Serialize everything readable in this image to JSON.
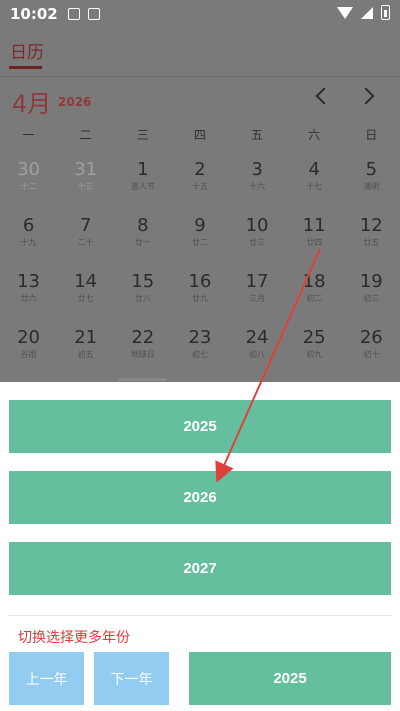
{
  "status": {
    "time": "10:02"
  },
  "calendar": {
    "tab": "日历",
    "month": "4月",
    "year": "2026",
    "weekdays": [
      "一",
      "二",
      "三",
      "四",
      "五",
      "六",
      "日"
    ],
    "weeks": [
      [
        {
          "d": "30",
          "l": "十二",
          "dim": true
        },
        {
          "d": "31",
          "l": "十三",
          "dim": true
        },
        {
          "d": "1",
          "l": "愚人节"
        },
        {
          "d": "2",
          "l": "十五"
        },
        {
          "d": "3",
          "l": "十六"
        },
        {
          "d": "4",
          "l": "十七"
        },
        {
          "d": "5",
          "l": "清明"
        }
      ],
      [
        {
          "d": "6",
          "l": "十九"
        },
        {
          "d": "7",
          "l": "二十"
        },
        {
          "d": "8",
          "l": "廿一"
        },
        {
          "d": "9",
          "l": "廿二"
        },
        {
          "d": "10",
          "l": "廿三"
        },
        {
          "d": "11",
          "l": "廿四"
        },
        {
          "d": "12",
          "l": "廿五"
        }
      ],
      [
        {
          "d": "13",
          "l": "廿六"
        },
        {
          "d": "14",
          "l": "廿七"
        },
        {
          "d": "15",
          "l": "廿八"
        },
        {
          "d": "16",
          "l": "廿九"
        },
        {
          "d": "17",
          "l": "三月"
        },
        {
          "d": "18",
          "l": "初二"
        },
        {
          "d": "19",
          "l": "初三"
        }
      ],
      [
        {
          "d": "20",
          "l": "谷雨"
        },
        {
          "d": "21",
          "l": "初五"
        },
        {
          "d": "22",
          "l": "地球日"
        },
        {
          "d": "23",
          "l": "初七"
        },
        {
          "d": "24",
          "l": "初八"
        },
        {
          "d": "25",
          "l": "初九"
        },
        {
          "d": "26",
          "l": "初十"
        }
      ]
    ]
  },
  "picker": {
    "years": [
      "2025",
      "2026",
      "2027"
    ],
    "hint": "切换选择更多年份",
    "prev_label": "上一年",
    "next_label": "下一年",
    "current_label": "2025"
  },
  "colors": {
    "green": "#65bf9c",
    "blue": "#92cdf1",
    "hint": "#e03a3a",
    "arrow": "#e0403a"
  }
}
